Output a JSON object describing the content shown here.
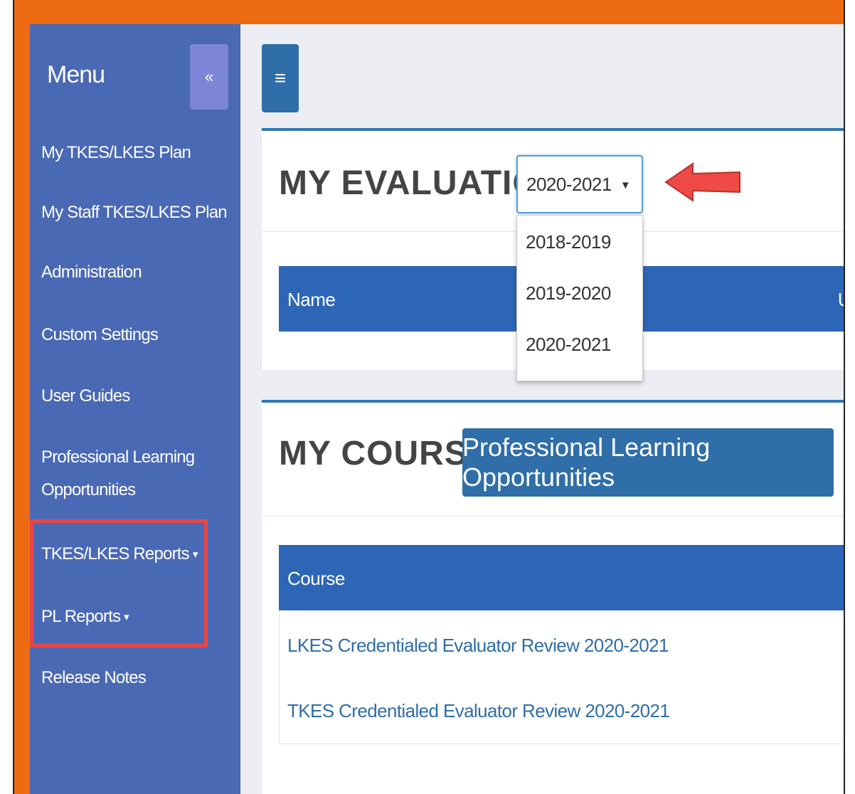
{
  "top_banner": {
    "text": ""
  },
  "sidebar": {
    "title": "Menu",
    "collapse_icon": "«",
    "items": [
      {
        "label": "My TKES/LKES Plan"
      },
      {
        "label": "My Staff TKES/LKES Plan"
      },
      {
        "label": "Administration"
      },
      {
        "label": "Custom Settings"
      },
      {
        "label": "User Guides"
      },
      {
        "label": "Professional Learning"
      },
      {
        "label": "Opportunities"
      },
      {
        "label": "TKES/LKES Reports",
        "caret": "▾"
      },
      {
        "label": "PL Reports",
        "caret": "▾"
      },
      {
        "label": "Release Notes"
      }
    ]
  },
  "header": {
    "menu_icon": "≡"
  },
  "evaluation": {
    "title": "MY EVALUATION",
    "selected_year": "2020-2021",
    "select_caret": "▼",
    "year_options": [
      "2018-2019",
      "2019-2020",
      "2020-2021"
    ],
    "table_header_name": "Name",
    "table_header_partial": "U"
  },
  "courses": {
    "title": "MY COURSES",
    "pl_button_label": "Professional Learning Opportunities",
    "table_header_course": "Course",
    "rows": [
      "LKES Credentialed Evaluator Review 2020-2021",
      "TKES Credentialed Evaluator Review 2020-2021"
    ]
  },
  "colors": {
    "orange_frame": "#ec6a12",
    "sidebar_bg": "#4a69b4",
    "table_header": "#2d66b6",
    "button_blue": "#2f6ea8",
    "highlight_red": "#e74646",
    "link_blue": "#2f6ea8"
  }
}
